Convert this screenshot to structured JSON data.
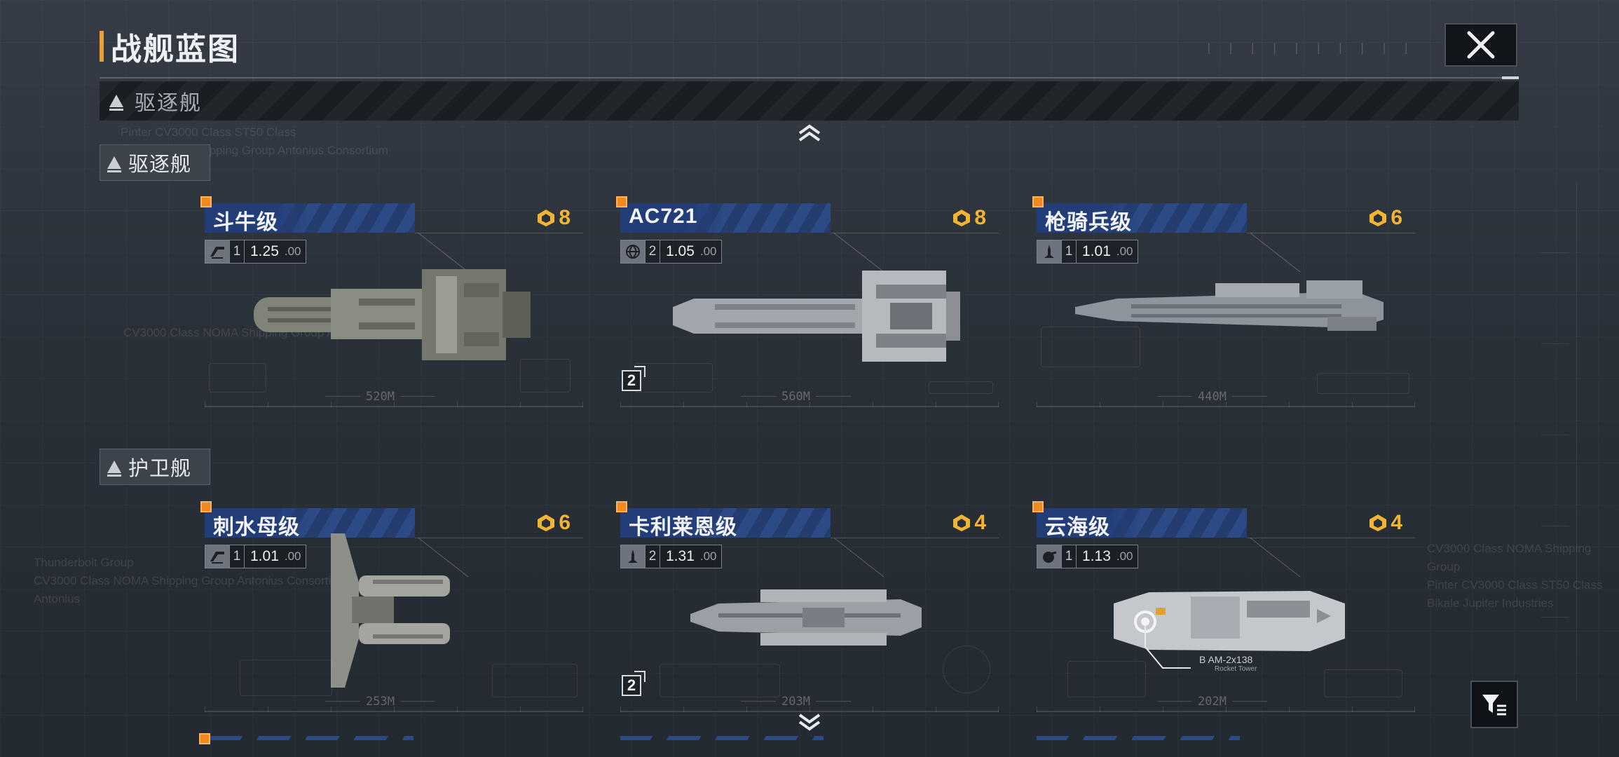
{
  "header": {
    "title": "战舰蓝图",
    "top_ticks": "| | | |  | | | | | |"
  },
  "category_strip": {
    "label": "驱逐舰"
  },
  "sections": [
    {
      "label": "驱逐舰"
    },
    {
      "label": "护卫舰"
    }
  ],
  "ships": [
    {
      "name": "斗牛级",
      "cost": "8",
      "role_icon": "missile-launcher-icon",
      "level": "1",
      "stat": "1.25",
      "stat_dec": ".00",
      "length": "520M",
      "badge": ""
    },
    {
      "name": "AC721",
      "cost": "8",
      "role_icon": "globe-icon",
      "level": "2",
      "stat": "1.05",
      "stat_dec": ".00",
      "length": "560M",
      "badge": "2"
    },
    {
      "name": "枪骑兵级",
      "cost": "6",
      "role_icon": "fighter-icon",
      "level": "1",
      "stat": "1.01",
      "stat_dec": ".00",
      "length": "440M",
      "badge": ""
    },
    {
      "name": "刺水母级",
      "cost": "6",
      "role_icon": "missile-launcher-icon",
      "level": "1",
      "stat": "1.01",
      "stat_dec": ".00",
      "length": "253M",
      "badge": ""
    },
    {
      "name": "卡利莱恩级",
      "cost": "4",
      "role_icon": "fighter-icon",
      "level": "2",
      "stat": "1.31",
      "stat_dec": ".00",
      "length": "203M",
      "badge": "2"
    },
    {
      "name": "云海级",
      "cost": "4",
      "role_icon": "cannon-icon",
      "level": "1",
      "stat": "1.13",
      "stat_dec": ".00",
      "length": "202M",
      "badge": ""
    }
  ],
  "callout": {
    "line1": "B AM-2x138",
    "line2": "Rocket Tower"
  },
  "bg_text": {
    "block1": [
      "Pinter CV3000 Class ST50 Class",
      "Class NOMA Shipping Group Antonius Consortium"
    ],
    "block2": [
      "Thunderbolt Group",
      "CV3000 Class NOMA Shipping Group Antonius Consortium",
      "Antonius"
    ],
    "block3": [
      "CV3000 Class NOMA Shipping Group",
      "Pinter CV3000 Class ST50 Class",
      "Bikale Jupiter Industries"
    ],
    "block4": "CV3000 Class NOMA Shipping Group Antonius"
  },
  "colors": {
    "accent": "#f08a1e",
    "cost": "#f2b433",
    "namebar": "#2c4a86",
    "bg": "#2a3038"
  }
}
